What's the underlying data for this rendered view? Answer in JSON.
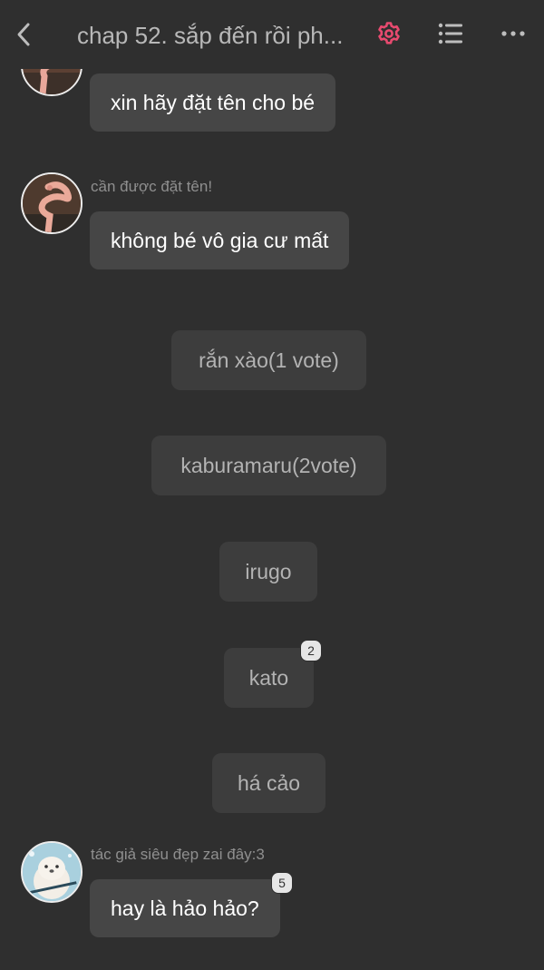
{
  "header": {
    "title": "chap 52. sắp đến rồi ph...",
    "back_icon": "chevron-left-icon",
    "settings_icon": "gear-icon",
    "list_icon": "list-icon",
    "more_icon": "more-horizontal-icon",
    "accent_color": "#e84a6f"
  },
  "messages": [
    {
      "sender": "",
      "text": "xin hãy đặt tên cho bé",
      "avatar": "snake-avatar"
    },
    {
      "sender": "cần được đặt tên!",
      "text": "không bé vô gia cư mất",
      "avatar": "snake-avatar"
    },
    {
      "sender": "tác giả siêu đẹp zai đây:3",
      "text": "hay là hảo hảo?",
      "avatar": "otter-avatar",
      "reaction_count": "5"
    }
  ],
  "options": [
    {
      "label": "rắn xào(1 vote)"
    },
    {
      "label": "kaburamaru(2vote)"
    },
    {
      "label": "irugo"
    },
    {
      "label": "kato",
      "reaction_count": "2"
    },
    {
      "label": "há cảo"
    }
  ]
}
